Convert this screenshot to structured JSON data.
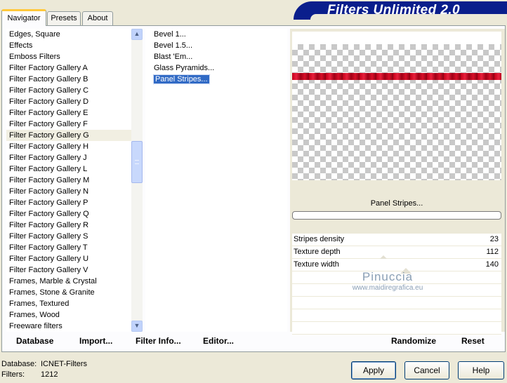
{
  "tabs": [
    {
      "label": "Navigator"
    },
    {
      "label": "Presets"
    },
    {
      "label": "About"
    }
  ],
  "app_title": "Filters Unlimited 2.0",
  "categories": [
    "Edges, Square",
    "Effects",
    "Emboss Filters",
    "Filter Factory Gallery A",
    "Filter Factory Gallery B",
    "Filter Factory Gallery C",
    "Filter Factory Gallery D",
    "Filter Factory Gallery E",
    "Filter Factory Gallery F",
    "Filter Factory Gallery G",
    "Filter Factory Gallery H",
    "Filter Factory Gallery J",
    "Filter Factory Gallery L",
    "Filter Factory Gallery M",
    "Filter Factory Gallery N",
    "Filter Factory Gallery P",
    "Filter Factory Gallery Q",
    "Filter Factory Gallery R",
    "Filter Factory Gallery S",
    "Filter Factory Gallery T",
    "Filter Factory Gallery U",
    "Filter Factory Gallery V",
    "Frames, Marble & Crystal",
    "Frames, Stone & Granite",
    "Frames, Textured",
    "Frames, Wood",
    "Freeware filters"
  ],
  "selected_category": "Filter Factory Gallery G",
  "filters": [
    "Bevel 1...",
    "Bevel 1.5...",
    "Blast 'Em...",
    "Glass Pyramids...",
    "Panel Stripes..."
  ],
  "selected_filter": "Panel Stripes...",
  "preview": {
    "filter_name": "Panel Stripes...",
    "watermark_line1": "Pinuccia",
    "watermark_line2": "www.maidiregrafica.eu"
  },
  "sliders": [
    {
      "label": "Stripes density",
      "value": "23"
    },
    {
      "label": "Texture depth",
      "value": "112"
    },
    {
      "label": "Texture width",
      "value": "140"
    }
  ],
  "toolbar": {
    "database": "Database",
    "import": "Import...",
    "filter_info": "Filter Info...",
    "editor": "Editor...",
    "randomize": "Randomize",
    "reset": "Reset"
  },
  "status": {
    "database_label": "Database:",
    "database_value": "ICNET-Filters",
    "filters_label": "Filters:",
    "filters_value": "1212"
  },
  "buttons": {
    "apply": "Apply",
    "cancel": "Cancel",
    "help": "Help"
  },
  "icons": {
    "scroll_up": "chevron-up-icon",
    "scroll_down": "chevron-down-icon"
  },
  "colors": {
    "title_banner": "#0a1e8c",
    "selection": "#316ac5",
    "active_tab_accent": "#ffc83c",
    "stripe_red": "#c4001a"
  }
}
